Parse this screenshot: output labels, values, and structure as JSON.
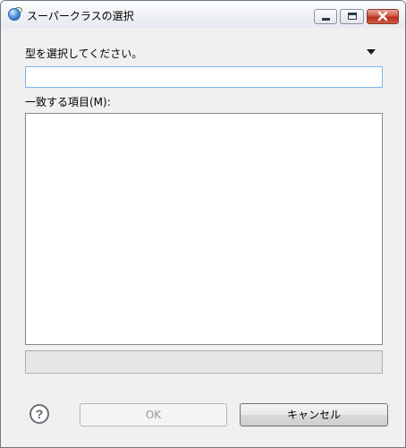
{
  "window": {
    "title": "スーパークラスの選択",
    "app_icon": "eclipse-globe-icon",
    "controls": [
      "minimize-icon",
      "maximize-icon",
      "close-icon"
    ],
    "close_color": "#c8432b"
  },
  "form": {
    "type_label": "型を選択してください。",
    "type_value": "",
    "type_placeholder": "",
    "menu_icon": "triangle-down-icon",
    "match_label": "一致する項目(M):",
    "matching_items": [],
    "status_text": ""
  },
  "footer": {
    "help_icon": "help-icon",
    "help_glyph": "?",
    "ok_label": "OK",
    "ok_enabled": false,
    "cancel_label": "キャンセル"
  },
  "colors": {
    "dialog_bg": "#f0f0f0",
    "input_focus_border": "#7eb4ea",
    "disabled_text": "#9a9a9a"
  }
}
